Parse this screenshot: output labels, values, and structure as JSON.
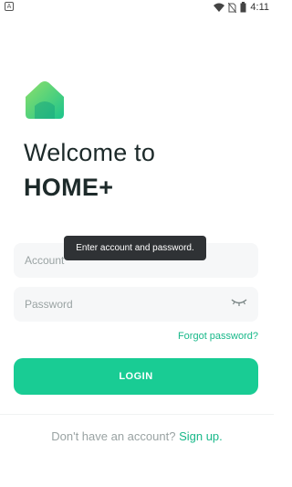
{
  "status_bar": {
    "notification_letter": "A",
    "time": "4:11"
  },
  "welcome": {
    "line1": "Welcome to",
    "brand": "HOME+"
  },
  "form": {
    "account_placeholder": "Account",
    "password_placeholder": "Password",
    "forgot_label": "Forgot password?",
    "login_label": "LOGIN"
  },
  "tooltip": {
    "text": "Enter account and password."
  },
  "signup": {
    "prompt": "Don't have an account?",
    "link": "Sign up."
  },
  "colors": {
    "accent": "#19cc94",
    "link": "#17b889",
    "field_bg": "#f6f7f8",
    "tooltip_bg": "#2f3235"
  },
  "icons": [
    "notification-a-icon",
    "wifi-icon",
    "no-sim-icon",
    "battery-icon",
    "home-logo-icon",
    "eye-closed-icon"
  ]
}
